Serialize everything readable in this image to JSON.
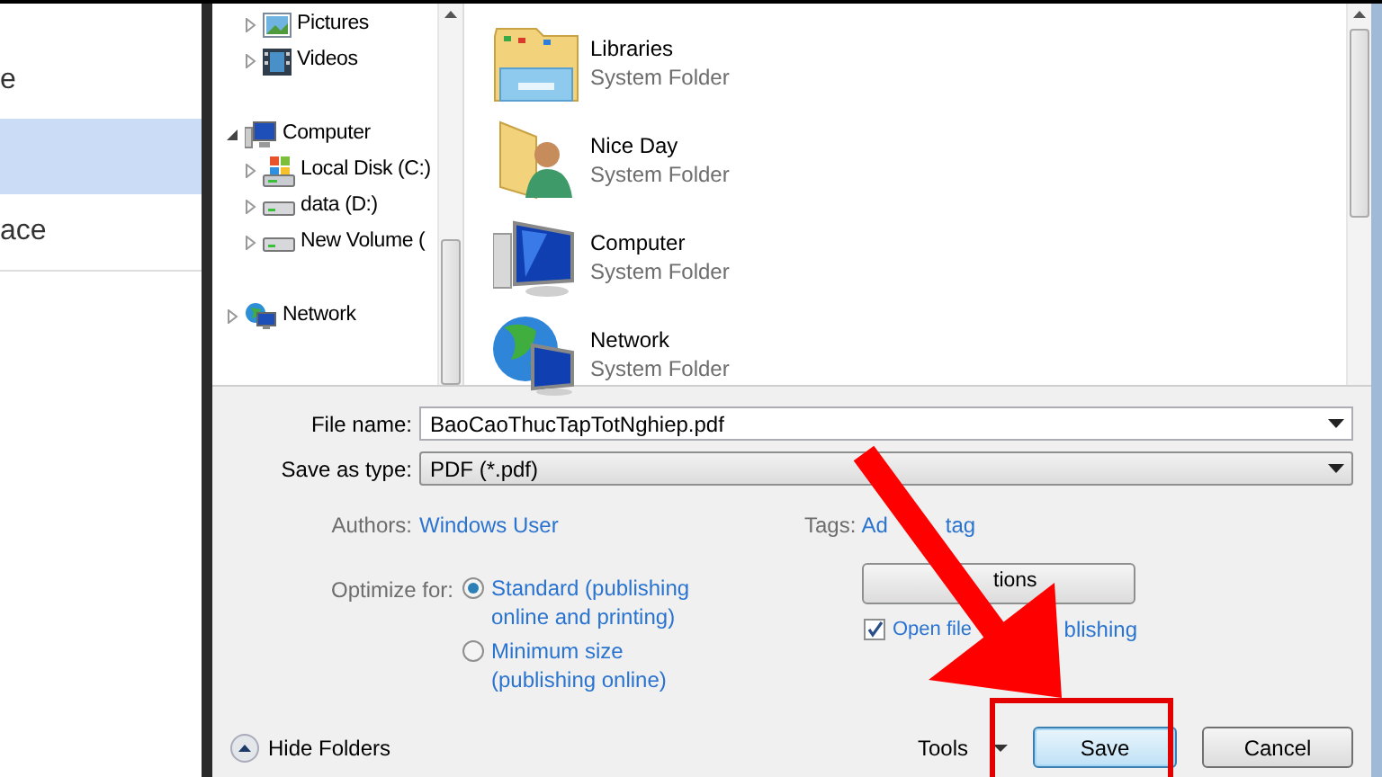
{
  "left_panel": {
    "items": [
      {
        "label": "e",
        "selected": false
      },
      {
        "selected": true
      },
      {
        "label": "ace",
        "selected": false
      }
    ]
  },
  "tree": {
    "items": [
      {
        "children": [
          {
            "label": "Pictures",
            "kind": "pictures",
            "expanded": false
          },
          {
            "label": "Videos",
            "kind": "videos",
            "expanded": false
          }
        ]
      },
      {
        "label": "Computer",
        "kind": "computer",
        "expanded": true,
        "children": [
          {
            "label": "Local Disk (C:)",
            "kind": "system-disk",
            "expanded": false
          },
          {
            "label": "data (D:)",
            "kind": "drive",
            "expanded": false
          },
          {
            "label": "New Volume (",
            "kind": "drive",
            "expanded": false
          }
        ]
      },
      {
        "label": "Network",
        "kind": "network",
        "expanded": false
      }
    ]
  },
  "folders": [
    {
      "name": "Libraries",
      "type": "System Folder",
      "kind": "libraries"
    },
    {
      "name": "Nice Day",
      "type": "System Folder",
      "kind": "user"
    },
    {
      "name": "Computer",
      "type": "System Folder",
      "kind": "computer"
    },
    {
      "name": "Network",
      "type": "System Folder",
      "kind": "network"
    }
  ],
  "form": {
    "file_name_label": "File name:",
    "file_name": "BaoCaoThucTapTotNghiep.pdf",
    "type_label": "Save as type:",
    "type": "PDF (*.pdf)",
    "authors_label": "Authors:",
    "authors": "Windows User",
    "tags_label": "Tags:",
    "tags_parts": [
      "Ad",
      "tag"
    ],
    "optimize_label": "Optimize for:",
    "optimize_options": [
      {
        "label": "Standard (publishing online and printing)",
        "selected": true
      },
      {
        "label": "Minimum size (publishing online)",
        "selected": false
      }
    ],
    "options_button": "tions",
    "open_after": {
      "label_parts": [
        "Open file",
        "blishing"
      ],
      "checked": true
    }
  },
  "footer": {
    "hide_folders": "Hide Folders",
    "tools": "Tools",
    "save": "Save",
    "cancel": "Cancel"
  },
  "annotation_arrow": true,
  "highlight_frame": true
}
